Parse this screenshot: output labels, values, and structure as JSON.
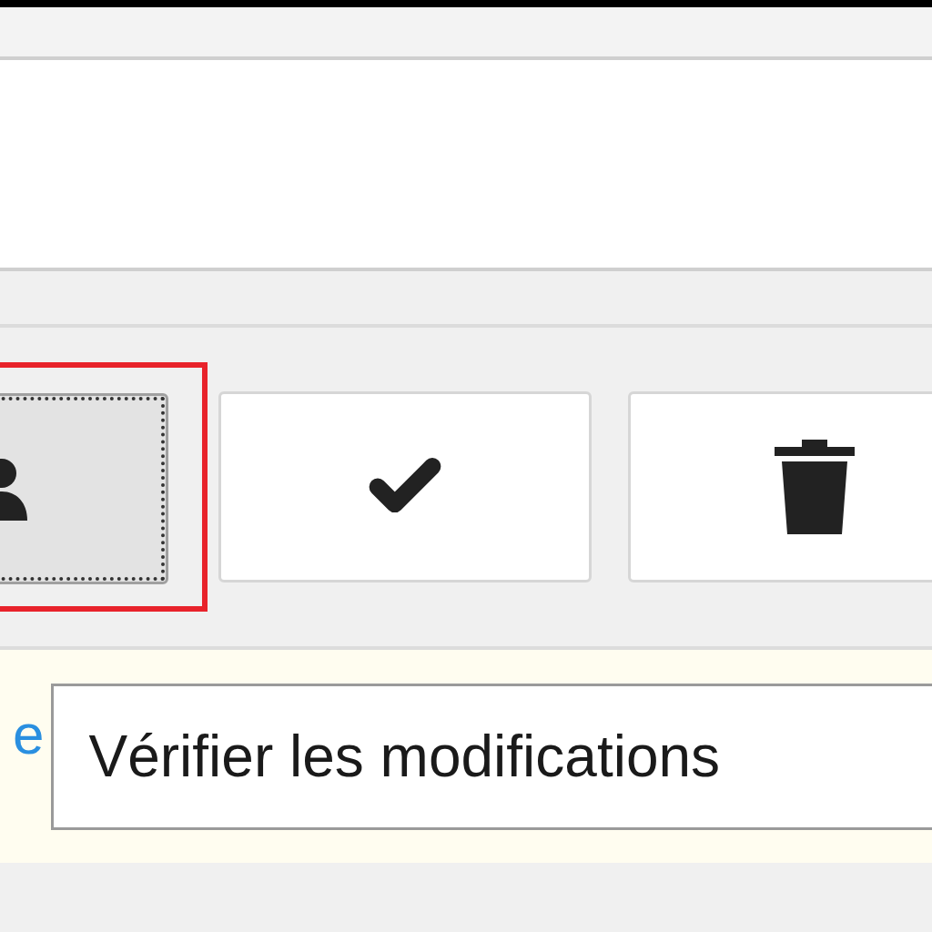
{
  "toolbar": {
    "buttons": [
      {
        "kind": "person",
        "selected": true
      },
      {
        "kind": "check",
        "selected": false
      },
      {
        "kind": "trash",
        "selected": false
      }
    ]
  },
  "form": {
    "label": "e",
    "field": {
      "value": "Vérifier les modifications"
    }
  }
}
